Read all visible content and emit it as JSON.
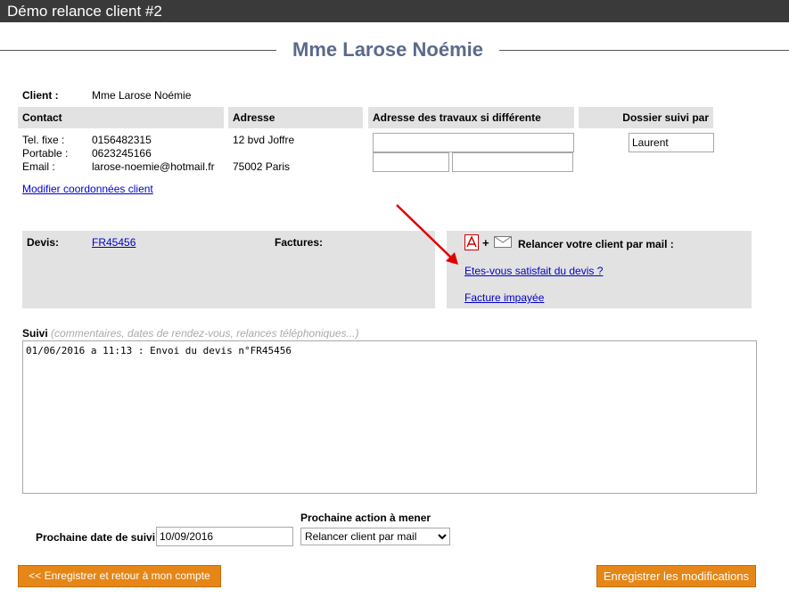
{
  "window": {
    "title": "Démo relance client #2"
  },
  "client": {
    "heading": "Mme Larose Noémie",
    "label": "Client :",
    "name": "Mme Larose Noémie"
  },
  "contact": {
    "header": "Contact",
    "phone_label": "Tel. fixe :",
    "phone": "0156482315",
    "mobile_label": "Portable :",
    "mobile": "0623245166",
    "email_label": "Email :",
    "email": "larose-noemie@hotmail.fr",
    "edit_link": "Modifier coordonnées client"
  },
  "address": {
    "header": "Adresse",
    "line1": "12 bvd Joffre",
    "line2": "75002 Paris"
  },
  "work_address": {
    "header": "Adresse des travaux si différente"
  },
  "followed_by": {
    "header": "Dossier suivi par",
    "value": "Laurent"
  },
  "quotes": {
    "label": "Devis:",
    "link": "FR45456",
    "invoices_label": "Factures:"
  },
  "reminder": {
    "title": "Relancer votre client par mail :",
    "plus": "+",
    "link_satisfied": "Etes-vous satisfait du devis ?",
    "link_unpaid": "Facture impayée",
    "icons": [
      "pdf-icon",
      "mail-icon"
    ],
    "arrow_color": "#e00000"
  },
  "followup": {
    "label": "Suivi",
    "hint": "(commentaires, dates de rendez-vous, relances téléphoniques...)",
    "text": "01/06/2016 a 11:13 : Envoi du devis n°FR45456"
  },
  "next": {
    "date_label": "Prochaine date de suivi",
    "date_value": "10/09/2016",
    "action_label": "Prochaine action à mener",
    "action_value": "Relancer client par mail"
  },
  "buttons": {
    "back": "<< Enregistrer et retour à mon compte",
    "save": "Enregistrer les modifications"
  },
  "colors": {
    "accent": "#e58617",
    "title_bar": "#3a3a3a",
    "heading": "#5a6a8a",
    "link": "#0000cc"
  }
}
